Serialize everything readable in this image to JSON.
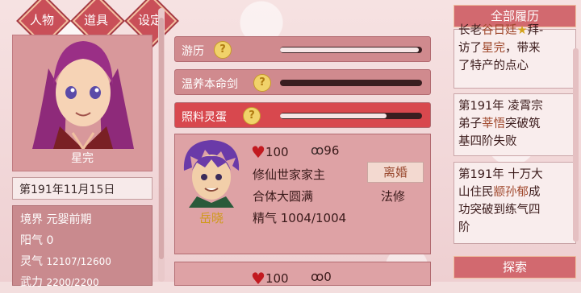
{
  "tabs": [
    "人物",
    "道具",
    "设定"
  ],
  "character": {
    "name": "星完",
    "date": "第191年11月15日",
    "realm_label": "境界",
    "realm": "元婴前期",
    "yang_label": "阳气",
    "yang": "0",
    "qi_label": "灵气",
    "qi": "12107/12600",
    "wuli_label": "武力",
    "wuli": "2200/2200"
  },
  "skills": [
    {
      "name": "游历",
      "progress": 0.98
    },
    {
      "name": "温养本命剑",
      "progress": 0.0
    },
    {
      "name": "照料灵蛋",
      "progress": 0.75
    }
  ],
  "partner": {
    "name": "岳晓",
    "heart": "100",
    "bond": "96",
    "identity": "修仙世家家主",
    "realm": "合体大圆满",
    "method": "法修",
    "vitality": "精气 1004/1004",
    "divorce_label": "离婚"
  },
  "partner2": {
    "heart": "100",
    "bond": "0"
  },
  "history": {
    "title": "全部履历",
    "entry0": {
      "line1a": "长老",
      "line1b": "谷日廷",
      "line2": "访了",
      "line2b": "星完",
      "line2c": "，带来",
      "line3": "了特产的点心"
    },
    "entry1": {
      "a": "第191年 凌霄宗",
      "b": "弟子",
      "c": "莘悟",
      "d": "突破筑",
      "e": "基四阶失败"
    },
    "entry2": {
      "a": "第191年 十万大",
      "b": "山住民",
      "c": "颛孙郁",
      "d": "成",
      "e": "功突破到练气四",
      "f": "阶"
    },
    "explore_label": "探索"
  },
  "colors": {
    "accent": "#d2696f",
    "active_skill": "#d8484e",
    "highlight_name": "#a0482c"
  }
}
